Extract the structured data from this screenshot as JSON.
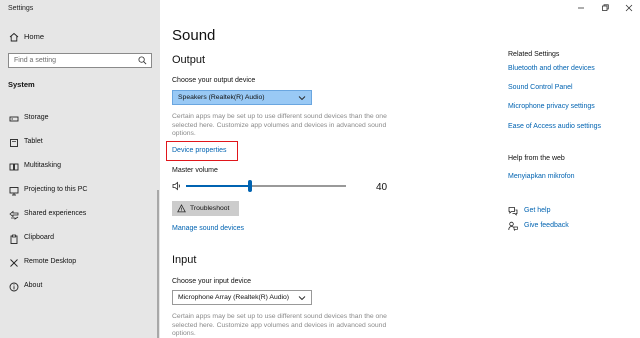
{
  "app": {
    "title": "Settings"
  },
  "sidebar": {
    "home_label": "Home",
    "search_placeholder": "Find a setting",
    "section_label": "System",
    "items": [
      {
        "label": "Storage",
        "icon": "storage-icon"
      },
      {
        "label": "Tablet",
        "icon": "tablet-icon"
      },
      {
        "label": "Multitasking",
        "icon": "multitasking-icon"
      },
      {
        "label": "Projecting to this PC",
        "icon": "projecting-icon"
      },
      {
        "label": "Shared experiences",
        "icon": "shared-experiences-icon"
      },
      {
        "label": "Clipboard",
        "icon": "clipboard-icon"
      },
      {
        "label": "Remote Desktop",
        "icon": "remote-desktop-icon"
      },
      {
        "label": "About",
        "icon": "info-icon"
      }
    ]
  },
  "main": {
    "title": "Sound",
    "output": {
      "heading": "Output",
      "device_label": "Choose your output device",
      "device_value": "Speakers (Realtek(R) Audio)",
      "description": "Certain apps may be set up to use different sound devices than the one selected here. Customize app volumes and devices in advanced sound options.",
      "device_properties_link": "Device properties",
      "master_volume_label": "Master volume",
      "master_volume_value": "40",
      "volume_level": 0.4,
      "troubleshoot_label": "Troubleshoot",
      "manage_link": "Manage sound devices"
    },
    "input": {
      "heading": "Input",
      "device_label": "Choose your input device",
      "device_value": "Microphone Array (Realtek(R) Audio)",
      "description": "Certain apps may be set up to use different sound devices than the one selected here. Customize app volumes and devices in advanced sound options."
    }
  },
  "related": {
    "title": "Related Settings",
    "links": [
      "Bluetooth and other devices",
      "Sound Control Panel",
      "Microphone privacy settings",
      "Ease of Access audio settings"
    ],
    "help_title": "Help from the web",
    "help_link": "Menyiapkan mikrofon",
    "get_help": "Get help",
    "give_feedback": "Give feedback"
  },
  "colors": {
    "accent": "#0063b1",
    "highlight": "#e0161b",
    "sidebar_bg": "#e6e6e6"
  }
}
